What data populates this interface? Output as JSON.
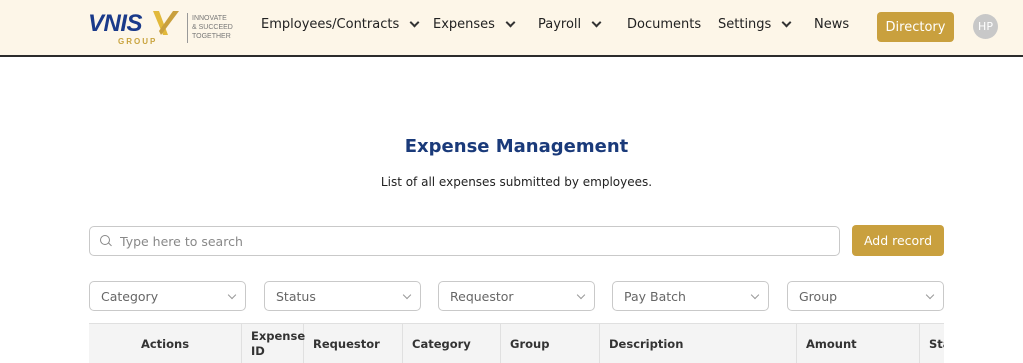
{
  "brand": {
    "name": "VNIS",
    "sub": "GROUP",
    "tagline": [
      "INNOVATE",
      "& SUCCEED",
      "TOGETHER"
    ]
  },
  "nav": {
    "items": [
      {
        "label": "Employees/Contracts",
        "has_dropdown": true
      },
      {
        "label": "Expenses",
        "has_dropdown": true
      },
      {
        "label": "Payroll",
        "has_dropdown": true
      },
      {
        "label": "Documents",
        "has_dropdown": false
      },
      {
        "label": "Settings",
        "has_dropdown": true
      },
      {
        "label": "News",
        "has_dropdown": false
      }
    ],
    "directory_label": "Directory",
    "avatar_initials": "HP"
  },
  "page": {
    "title": "Expense Management",
    "subtitle": "List of all expenses submitted by employees."
  },
  "search": {
    "placeholder": "Type here to search",
    "value": ""
  },
  "add_record_label": "Add record",
  "filters": [
    "Category",
    "Status",
    "Requestor",
    "Pay Batch",
    "Group"
  ],
  "table": {
    "columns": [
      "Actions",
      "Expense ID",
      "Requestor",
      "Category",
      "Group",
      "Description",
      "Amount",
      "Status"
    ]
  },
  "colors": {
    "accent": "#c9a03e",
    "navy": "#1a3a7a",
    "nav_bg": "#fdf6e8"
  }
}
